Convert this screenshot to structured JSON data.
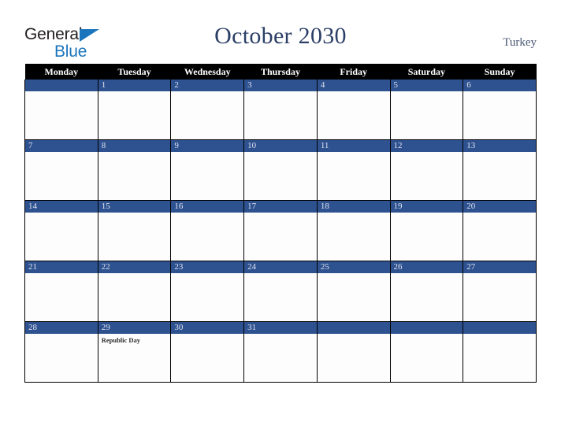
{
  "brand": {
    "name_part1": "General",
    "name_part2": "Blue",
    "logo_icon": "blue-triangle-icon",
    "color_dark": "#231f20",
    "color_blue": "#1b75bc"
  },
  "header": {
    "title": "October 2030",
    "country": "Turkey",
    "title_color": "#2b3f66"
  },
  "calendar": {
    "month": "October",
    "year": "2030",
    "accent_color": "#2e5190",
    "header_bg": "#000000",
    "weekday_headers": [
      "Monday",
      "Tuesday",
      "Wednesday",
      "Thursday",
      "Friday",
      "Saturday",
      "Sunday"
    ],
    "weeks": [
      [
        {
          "day": "",
          "events": []
        },
        {
          "day": "1",
          "events": []
        },
        {
          "day": "2",
          "events": []
        },
        {
          "day": "3",
          "events": []
        },
        {
          "day": "4",
          "events": []
        },
        {
          "day": "5",
          "events": []
        },
        {
          "day": "6",
          "events": []
        }
      ],
      [
        {
          "day": "7",
          "events": []
        },
        {
          "day": "8",
          "events": []
        },
        {
          "day": "9",
          "events": []
        },
        {
          "day": "10",
          "events": []
        },
        {
          "day": "11",
          "events": []
        },
        {
          "day": "12",
          "events": []
        },
        {
          "day": "13",
          "events": []
        }
      ],
      [
        {
          "day": "14",
          "events": []
        },
        {
          "day": "15",
          "events": []
        },
        {
          "day": "16",
          "events": []
        },
        {
          "day": "17",
          "events": []
        },
        {
          "day": "18",
          "events": []
        },
        {
          "day": "19",
          "events": []
        },
        {
          "day": "20",
          "events": []
        }
      ],
      [
        {
          "day": "21",
          "events": []
        },
        {
          "day": "22",
          "events": []
        },
        {
          "day": "23",
          "events": []
        },
        {
          "day": "24",
          "events": []
        },
        {
          "day": "25",
          "events": []
        },
        {
          "day": "26",
          "events": []
        },
        {
          "day": "27",
          "events": []
        }
      ],
      [
        {
          "day": "28",
          "events": []
        },
        {
          "day": "29",
          "events": [
            "Republic Day"
          ]
        },
        {
          "day": "30",
          "events": []
        },
        {
          "day": "31",
          "events": []
        },
        {
          "day": "",
          "events": []
        },
        {
          "day": "",
          "events": []
        },
        {
          "day": "",
          "events": []
        }
      ]
    ]
  }
}
